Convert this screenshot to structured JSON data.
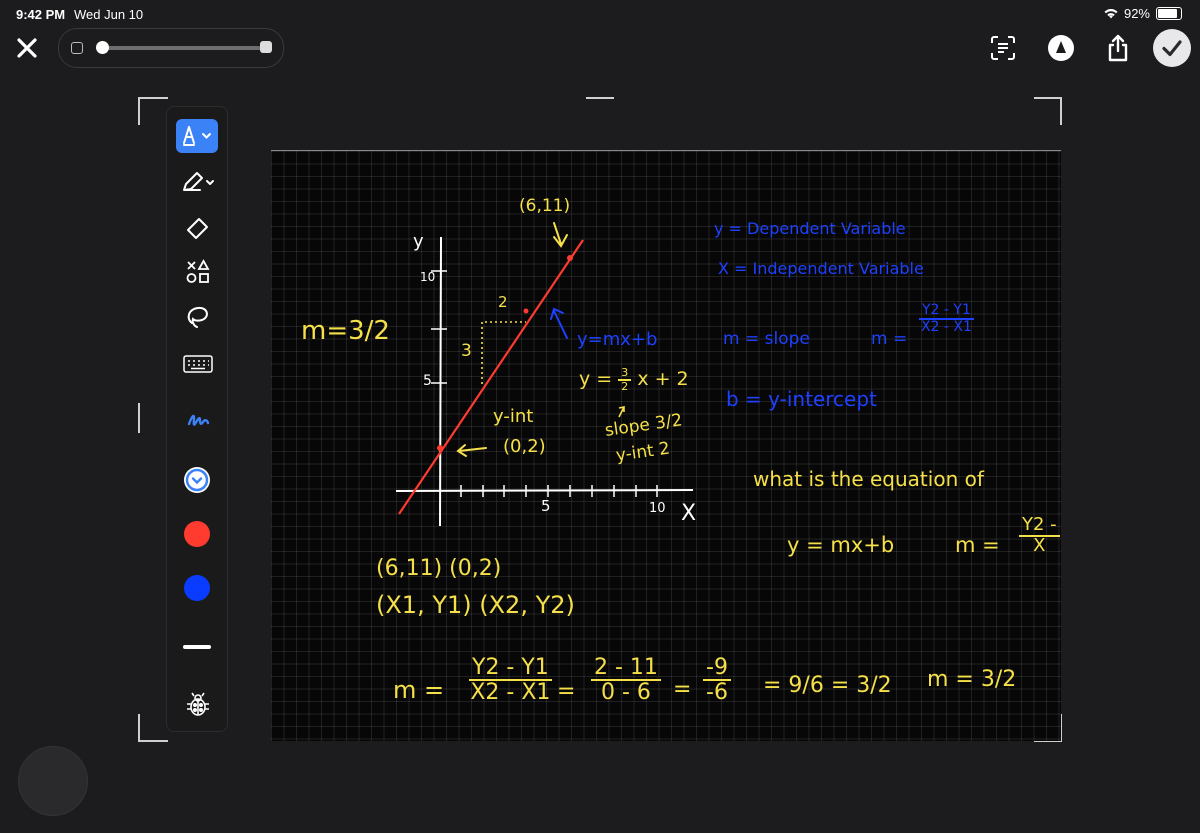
{
  "status": {
    "time": "9:42 PM",
    "date": "Wed Jun 10",
    "battery": "92%"
  },
  "toolbar": {
    "tools": [
      "pen-tool",
      "highlighter-tool",
      "eraser-tool",
      "shapes-tool",
      "lasso-tool",
      "keyboard-tool",
      "handwriting-tool"
    ],
    "colors": {
      "active_tool": "#3b82f6",
      "swatch_red": "#ff3b30",
      "swatch_blue": "#0a3cff"
    }
  },
  "ink": {
    "slope_left": "m=3/2",
    "point_label": "(6,11)",
    "axis_y": "y",
    "tick_10": "10",
    "tick_5": "5",
    "rise": "3",
    "run": "2",
    "yint_label": "y-int",
    "yint_point": "(0,2)",
    "xtick_5": "5",
    "xtick_10": "10",
    "axis_x": "X",
    "eq_general": "y=mx+b",
    "eq_specific_lhs": "y =",
    "eq_frac_num": "3",
    "eq_frac_den": "2",
    "eq_specific_rhs": "x + 2",
    "slope_note": "slope 3/2",
    "yint_note": "y-int 2",
    "blue_dep": "y = Dependent Variable",
    "blue_ind": "X = Independent Variable",
    "blue_m": "m = slope",
    "blue_m2": "m =",
    "blue_num": "Y2 - Y1",
    "blue_den": "X2 - X1",
    "blue_b": "b = y-intercept",
    "question": "what is the equation of",
    "eq_form": "y = mx+b",
    "m_eq": "m =",
    "m_num": "Y2 -",
    "m_den": "X",
    "points": "(6,11)  (0,2)",
    "points_general": "(X1, Y1)  (X2, Y2)",
    "calc_m": "m =",
    "calc_num1": "Y2 - Y1",
    "calc_den1": "X2 - X1",
    "calc_num2": "2 - 11",
    "calc_den2": "0 - 6",
    "calc_num3": "-9",
    "calc_den3": "-6",
    "calc_reduce": "= 9/6 = 3/2",
    "calc_result": "m = 3/2",
    "colors": {
      "yellow": "#f5e04a",
      "blue": "#1e40ff",
      "red": "#ff3b30"
    }
  }
}
